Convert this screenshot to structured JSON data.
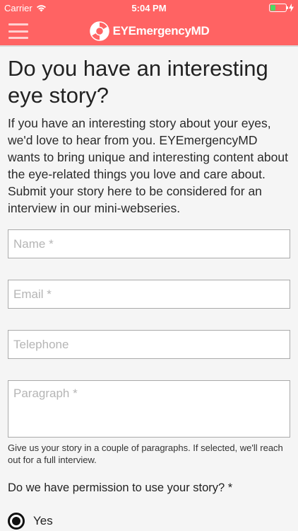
{
  "status": {
    "carrier": "Carrier",
    "time": "5:04 PM",
    "battery_fill_fraction": 0.35
  },
  "nav": {
    "brand": "EYEmergencyMD",
    "menu_icon": "hamburger-icon",
    "logo_icon": "lifebuoy-icon"
  },
  "colors": {
    "header": "#ff6363",
    "battery_fill": "#4cd964"
  },
  "page": {
    "title": "Do you have an interesting eye story?",
    "intro": "If you have an interesting story about your eyes, we'd love to hear from you. EYEmergencyMD wants to bring unique and interesting content about the eye-related things you love and care about. Submit your story here to be considered for an interview in our mini-webseries."
  },
  "form": {
    "name_placeholder": "Name *",
    "email_placeholder": "Email *",
    "telephone_placeholder": "Telephone",
    "paragraph_placeholder": "Paragraph *",
    "paragraph_help": "Give us your story in a couple of paragraphs. If selected, we'll reach out for a full interview.",
    "permission_question": "Do we have permission to use your story? *",
    "options": [
      {
        "label": "Yes",
        "selected": true
      }
    ]
  }
}
